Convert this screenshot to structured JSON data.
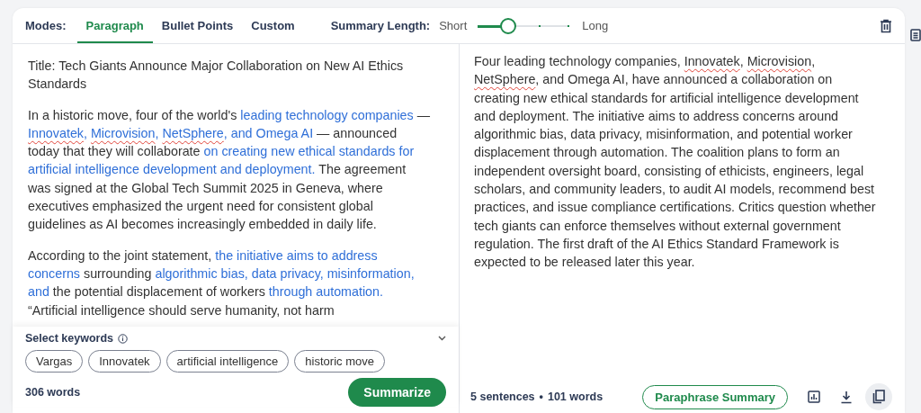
{
  "modes": {
    "label": "Modes:",
    "tabs": [
      {
        "label": "Paragraph",
        "selected": true
      },
      {
        "label": "Bullet Points",
        "selected": false
      },
      {
        "label": "Custom",
        "selected": false
      }
    ]
  },
  "summary_length": {
    "label": "Summary Length:",
    "min_label": "Short",
    "max_label": "Long",
    "level": 0.33
  },
  "source": {
    "paragraphs": [
      [
        {
          "text": "Title: Tech Giants Announce Major Collaboration on New AI Ethics Standards",
          "kind": "plain"
        }
      ],
      [
        {
          "text": "In a historic move, four of the world's ",
          "kind": "plain"
        },
        {
          "text": "leading technology companies",
          "kind": "key"
        },
        {
          "text": " — ",
          "kind": "plain"
        },
        {
          "text": "Innovatek",
          "kind": "key-flagged"
        },
        {
          "text": ", ",
          "kind": "key"
        },
        {
          "text": "Microvision",
          "kind": "key-flagged"
        },
        {
          "text": ", ",
          "kind": "key"
        },
        {
          "text": "NetSphere",
          "kind": "key-flagged"
        },
        {
          "text": ", and Omega AI",
          "kind": "key"
        },
        {
          "text": " — announced today that they will collaborate ",
          "kind": "plain"
        },
        {
          "text": "on creating new ethical standards for artificial intelligence development and deployment.",
          "kind": "key"
        },
        {
          "text": " The agreement was signed at the Global Tech Summit 2025 in Geneva, where executives emphasized the urgent need for consistent global guidelines as AI becomes increasingly embedded in daily life.",
          "kind": "plain"
        }
      ],
      [
        {
          "text": "According to the joint statement, ",
          "kind": "plain"
        },
        {
          "text": "the initiative aims to address concerns",
          "kind": "key"
        },
        {
          "text": " surrounding ",
          "kind": "plain"
        },
        {
          "text": "algorithmic bias, data privacy, misinformation, and",
          "kind": "key"
        },
        {
          "text": " the potential displacement of workers ",
          "kind": "plain"
        },
        {
          "text": "through automation.",
          "kind": "key"
        },
        {
          "text": " “Artificial intelligence should serve humanity, not harm",
          "kind": "plain"
        }
      ]
    ],
    "keywords": {
      "label": "Select keywords",
      "chips": [
        "Vargas",
        "Innovatek",
        "artificial intelligence",
        "historic move"
      ]
    },
    "word_count": "306 words",
    "action": "Summarize"
  },
  "summary": {
    "paragraphs": [
      [
        {
          "text": "Four leading technology companies, ",
          "kind": "plain"
        },
        {
          "text": "Innovatek",
          "kind": "flagged"
        },
        {
          "text": ", ",
          "kind": "plain"
        },
        {
          "text": "Microvision",
          "kind": "flagged"
        },
        {
          "text": ", ",
          "kind": "plain"
        },
        {
          "text": "NetSphere",
          "kind": "flagged"
        },
        {
          "text": ", and Omega AI, have announced a collaboration on creating new ethical standards for artificial intelligence development and deployment. The initiative aims to address concerns around algorithmic bias, data privacy, misinformation, and potential worker displacement through automation. The coalition plans to form an independent oversight board, consisting of ethicists, engineers, legal scholars, and community leaders, to audit AI models, recommend best practices, and issue compliance certifications. Critics question whether tech giants can enforce themselves without external government regulation. The first draft of the AI Ethics Standard Framework is expected to be released later this year.",
          "kind": "plain"
        }
      ]
    ],
    "sentence_count": "5 sentences",
    "separator": "•",
    "word_count": "101 words",
    "action": "Paraphrase Summary"
  }
}
